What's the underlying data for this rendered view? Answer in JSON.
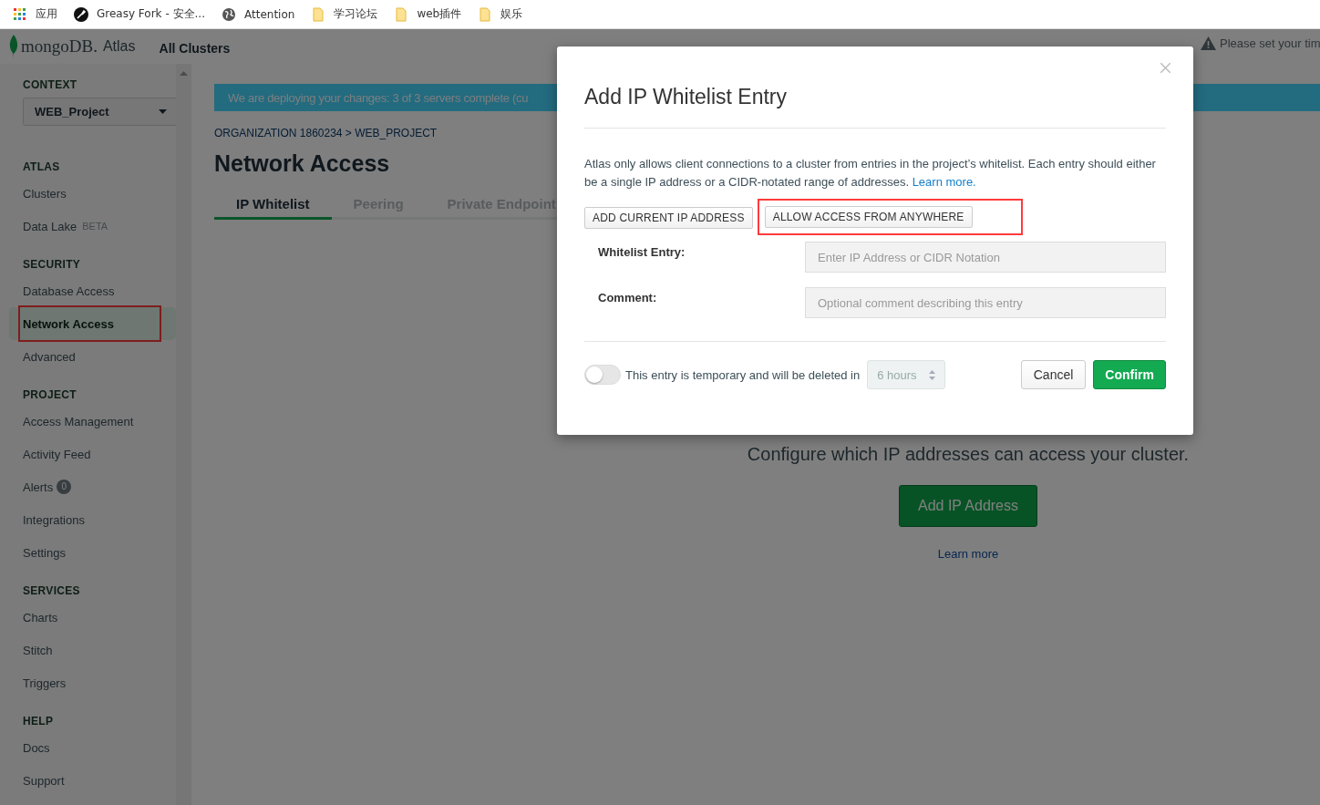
{
  "bookmarks": [
    {
      "label": "应用",
      "kind": "apps"
    },
    {
      "label": "Greasy Fork - 安全...",
      "kind": "site"
    },
    {
      "label": "Attention",
      "kind": "globe"
    },
    {
      "label": "学习论坛",
      "kind": "folder"
    },
    {
      "label": "web插件",
      "kind": "folder"
    },
    {
      "label": "娱乐",
      "kind": "folder"
    }
  ],
  "header": {
    "logo_text": "mongoDB.",
    "logo_product": "Atlas",
    "nav": "All Clusters",
    "notice": "Please set your tim"
  },
  "sidebar": {
    "context_label": "CONTEXT",
    "project": "WEB_Project",
    "sections": [
      {
        "title": "ATLAS",
        "items": [
          {
            "label": "Clusters",
            "selected": false,
            "highlighted": false
          },
          {
            "label": "Data Lake",
            "tag": "BETA",
            "selected": false,
            "highlighted": false
          }
        ]
      },
      {
        "title": "SECURITY",
        "items": [
          {
            "label": "Database Access",
            "selected": false,
            "highlighted": false
          },
          {
            "label": "Network Access",
            "selected": true,
            "highlighted": true
          },
          {
            "label": "Advanced",
            "selected": false,
            "highlighted": false
          }
        ]
      },
      {
        "title": "PROJECT",
        "items": [
          {
            "label": "Access Management",
            "selected": false,
            "highlighted": false
          },
          {
            "label": "Activity Feed",
            "selected": false,
            "highlighted": false
          },
          {
            "label": "Alerts",
            "badge": "0",
            "selected": false,
            "highlighted": false
          },
          {
            "label": "Integrations",
            "selected": false,
            "highlighted": false
          },
          {
            "label": "Settings",
            "selected": false,
            "highlighted": false
          }
        ]
      },
      {
        "title": "SERVICES",
        "items": [
          {
            "label": "Charts",
            "selected": false,
            "highlighted": false
          },
          {
            "label": "Stitch",
            "selected": false,
            "highlighted": false
          },
          {
            "label": "Triggers",
            "selected": false,
            "highlighted": false
          }
        ]
      },
      {
        "title": "HELP",
        "items": [
          {
            "label": "Docs",
            "selected": false,
            "highlighted": false
          },
          {
            "label": "Support",
            "selected": false,
            "highlighted": false
          }
        ]
      }
    ]
  },
  "main": {
    "banner": "We are deploying your changes: 3 of 3 servers complete (cu",
    "breadcrumb": "ORGANIZATION 1860234 > WEB_PROJECT",
    "title": "Network Access",
    "tabs": [
      {
        "label": "IP Whitelist",
        "selected": true
      },
      {
        "label": "Peering",
        "selected": false
      },
      {
        "label": "Private Endpoint",
        "selected": false
      }
    ],
    "empty_state": {
      "subtitle": "Configure which IP addresses can access your cluster.",
      "button": "Add IP Address",
      "link": "Learn more"
    }
  },
  "dialog": {
    "title": "Add IP Whitelist Entry",
    "description": "Atlas only allows client connections to a cluster from entries in the project’s whitelist. Each entry should either be a single IP address or a CIDR-notated range of addresses.",
    "description_link": "Learn more.",
    "quick_buttons": [
      {
        "label": "ADD CURRENT IP ADDRESS",
        "highlighted": false
      },
      {
        "label": "ALLOW ACCESS FROM ANYWHERE",
        "highlighted": true
      }
    ],
    "fields": [
      {
        "label": "Whitelist Entry:",
        "placeholder": "Enter IP Address or CIDR Notation"
      },
      {
        "label": "Comment:",
        "placeholder": "Optional comment describing this entry"
      }
    ],
    "temporary": {
      "on": false,
      "label": "This entry is temporary and will be deleted in",
      "duration": "6 hours"
    },
    "cancel": "Cancel",
    "confirm": "Confirm"
  }
}
